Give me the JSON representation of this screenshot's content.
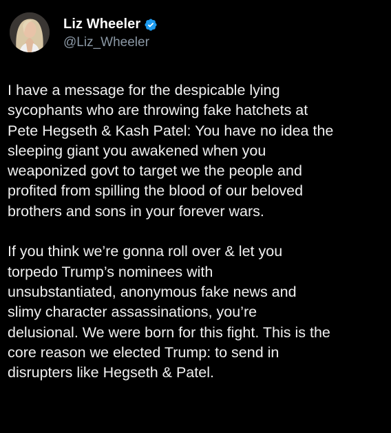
{
  "author": {
    "display_name": "Liz Wheeler",
    "handle": "@Liz_Wheeler",
    "verified": true,
    "verified_icon": "verified-badge-icon",
    "verified_color": "#1d9bf0"
  },
  "tweet": {
    "paragraphs": [
      [
        "I have a message for the despicable lying",
        "sycophants who are throwing fake hatchets at",
        "Pete Hegseth & Kash Patel: You have no idea the",
        "sleeping giant you awakened when you",
        "weaponized govt to target we the people and",
        "profited from spilling the blood of our beloved",
        "brothers and sons in your forever wars."
      ],
      [
        "If you think we’re gonna roll over & let you",
        "torpedo Trump’s nominees with",
        "unsubstantiated, anonymous fake news and",
        "slimy character assassinations, you’re",
        "delusional. We were born for this fight. This is the",
        "core reason we elected Trump: to send in",
        "disrupters like Hegseth & Patel."
      ]
    ]
  },
  "colors": {
    "background": "#000000",
    "text": "#f0f0f0",
    "handle": "#8b98a5"
  }
}
